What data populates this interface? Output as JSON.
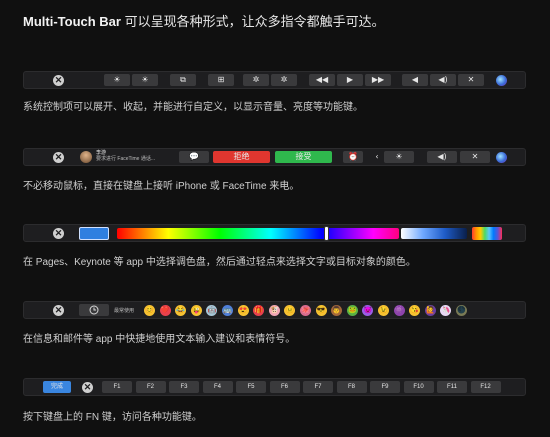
{
  "headline": {
    "bold": "Multi-Touch Bar",
    "rest": " 可以呈现各种形式，让众多指令都触手可达。"
  },
  "captions": [
    "系统控制项可以展开、收起，并能进行自定义，以显示音量、亮度等功能键。",
    "不必移动鼠标，直接在键盘上接听 iPhone 或 FaceTime 来电。",
    "在 Pages、Keynote 等 app 中选择调色盘，然后通过轻点来选择文字或目标对象的颜色。",
    "在信息和邮件等 app 中快捷地使用文本输入建议和表情符号。",
    "按下键盘上的 FN 键，访问各种功能键。"
  ],
  "bar1": {
    "close": "✕",
    "keys": [
      "☀",
      "☀",
      "⧉",
      "⊞",
      "✲",
      "✲",
      "◀◀",
      "▶",
      "▶▶",
      "◀",
      "◀)",
      "✕"
    ]
  },
  "bar2": {
    "close": "✕",
    "caller_name": "李游",
    "caller_status": "要求进行 FaceTime 通话...",
    "message": "💬",
    "decline": "拒绝",
    "accept": "接受",
    "alarm": "⏰",
    "chevron": "‹",
    "keys": [
      "☀",
      "◀)",
      "✕"
    ]
  },
  "bar3": {
    "close": "✕"
  },
  "bar4": {
    "close": "✕",
    "recent_label": "最常使用",
    "emojis": [
      "😊",
      "❤️",
      "😂",
      "😜",
      "🤖",
      "🚌",
      "😍",
      "🎁",
      "🐮",
      "😐",
      "🐙",
      "😎",
      "👨",
      "🐸",
      "😈",
      "😉",
      "👾",
      "😘",
      "🙋",
      "🦄",
      "🌑"
    ],
    "emoji_colors": [
      "#f6c233",
      "#e8414d",
      "#f6c233",
      "#f6c233",
      "#a7c7d8",
      "#4f7fd9",
      "#f6c233",
      "#e8414d",
      "#f2a7b7",
      "#f6c233",
      "#d96b8e",
      "#f6c233",
      "#a5683a",
      "#58b046",
      "#9b5de5",
      "#f6c233",
      "#8e44ad",
      "#f6c233",
      "#6b3fa0",
      "#e9d8f5",
      "#7a7a55"
    ]
  },
  "bar5": {
    "done": "完成",
    "close": "✕",
    "fkeys": [
      "F1",
      "F2",
      "F3",
      "F4",
      "F5",
      "F6",
      "F7",
      "F8",
      "F9",
      "F10",
      "F11",
      "F12"
    ]
  }
}
